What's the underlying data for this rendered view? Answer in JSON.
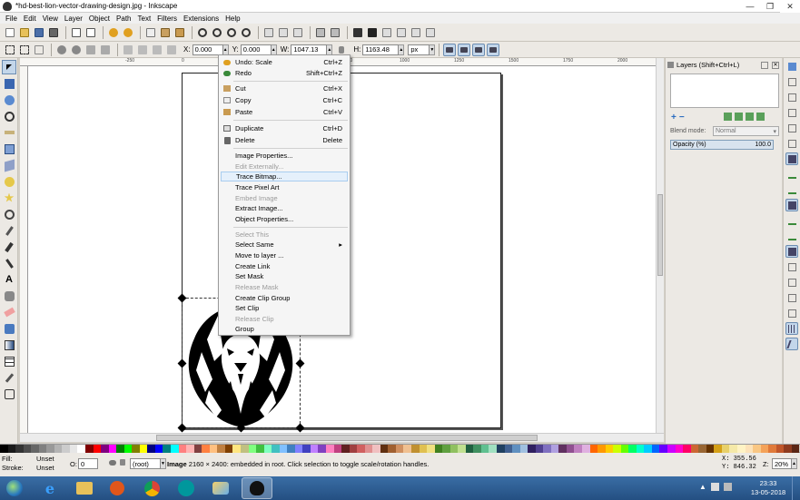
{
  "window": {
    "title": "*hd-best-lion-vector-drawing-design.jpg - Inkscape",
    "minimize_label": "—",
    "maximize_label": "❐",
    "close_label": "✕"
  },
  "menubar": [
    "File",
    "Edit",
    "View",
    "Layer",
    "Object",
    "Path",
    "Text",
    "Filters",
    "Extensions",
    "Help"
  ],
  "controls": {
    "x_label": "X:",
    "x_value": "0.000",
    "y_label": "Y:",
    "y_value": "0.000",
    "w_label": "W:",
    "w_value": "1047.13",
    "h_label": "H:",
    "h_value": "1163.48",
    "unit": "px"
  },
  "ruler_ticks": [
    "-250",
    "0",
    "250",
    "500",
    "750",
    "1000",
    "1250",
    "1500",
    "1750",
    "2000",
    "2250",
    "2500"
  ],
  "context_menu": [
    {
      "label": "Undo: Scale",
      "shortcut": "Ctrl+Z",
      "icon": "undo-icon",
      "enabled": true
    },
    {
      "label": "Redo",
      "shortcut": "Shift+Ctrl+Z",
      "icon": "redo-icon",
      "enabled": true
    },
    {
      "separator": true
    },
    {
      "label": "Cut",
      "shortcut": "Ctrl+X",
      "icon": "cut-icon",
      "enabled": true
    },
    {
      "label": "Copy",
      "shortcut": "Ctrl+C",
      "icon": "copy-icon",
      "enabled": true
    },
    {
      "label": "Paste",
      "shortcut": "Ctrl+V",
      "icon": "paste-icon",
      "enabled": true
    },
    {
      "separator": true
    },
    {
      "label": "Duplicate",
      "shortcut": "Ctrl+D",
      "icon": "duplicate-icon",
      "enabled": true
    },
    {
      "label": "Delete",
      "shortcut": "Delete",
      "icon": "delete-icon",
      "enabled": true
    },
    {
      "separator": true
    },
    {
      "label": "Image Properties...",
      "shortcut": "",
      "enabled": true
    },
    {
      "label": "Edit Externally...",
      "shortcut": "",
      "enabled": false
    },
    {
      "label": "Trace Bitmap...",
      "shortcut": "",
      "enabled": true,
      "highlighted": true
    },
    {
      "label": "Trace Pixel Art",
      "shortcut": "",
      "enabled": true
    },
    {
      "label": "Embed Image",
      "shortcut": "",
      "enabled": false
    },
    {
      "label": "Extract Image...",
      "shortcut": "",
      "enabled": true
    },
    {
      "label": "Object Properties...",
      "shortcut": "",
      "enabled": true
    },
    {
      "separator": true
    },
    {
      "label": "Select This",
      "shortcut": "",
      "enabled": false
    },
    {
      "label": "Select Same",
      "shortcut": "",
      "enabled": true,
      "submenu": true
    },
    {
      "label": "Move to layer ...",
      "shortcut": "",
      "enabled": true
    },
    {
      "label": "Create Link",
      "shortcut": "",
      "enabled": true
    },
    {
      "label": "Set Mask",
      "shortcut": "",
      "enabled": true
    },
    {
      "label": "Release Mask",
      "shortcut": "",
      "enabled": false
    },
    {
      "label": "Create Clip Group",
      "shortcut": "",
      "enabled": true
    },
    {
      "label": "Set Clip",
      "shortcut": "",
      "enabled": true
    },
    {
      "label": "Release Clip",
      "shortcut": "",
      "enabled": false
    },
    {
      "label": "Group",
      "shortcut": "",
      "enabled": true
    }
  ],
  "layers_panel": {
    "title": "Layers (Shift+Ctrl+L)",
    "blend_label": "Blend mode:",
    "blend_value": "Normal",
    "opacity_label": "Opacity (%)",
    "opacity_value": "100.0"
  },
  "status": {
    "fill_label": "Fill:",
    "fill_value": "Unset",
    "stroke_label": "Stroke:",
    "stroke_value": "Unset",
    "opacity_label": "O:",
    "opacity_value": "0",
    "layer_value": "(root)",
    "message_bold": "Image",
    "message": " 2160 × 2400: embedded in root. Click selection to toggle scale/rotation handles.",
    "x_label": "X:",
    "x_value": "355.56",
    "y_label": "Y:",
    "y_value": "846.32",
    "zoom_label": "Z:",
    "zoom_value": "20%"
  },
  "taskbar": {
    "time": "23:33",
    "date": "13-05-2018"
  },
  "colors": {
    "highlight": "#e5f0fb",
    "taskbar": "#2f5f95",
    "palette": [
      "#000000",
      "#1a1a1a",
      "#333333",
      "#4d4d4d",
      "#666666",
      "#808080",
      "#999999",
      "#b3b3b3",
      "#cccccc",
      "#e6e6e6",
      "#ffffff",
      "#800000",
      "#ff0000",
      "#800080",
      "#ff00ff",
      "#008000",
      "#00ff00",
      "#808000",
      "#ffff00",
      "#000080",
      "#0000ff",
      "#008080",
      "#00ffff",
      "#ff8080",
      "#ffb3b3",
      "#804040",
      "#ff8040",
      "#ffc080",
      "#c08040",
      "#804000",
      "#ffe680",
      "#c0c080",
      "#80ff80",
      "#40c040",
      "#80ffc0",
      "#40c0c0",
      "#80c0ff",
      "#4080c0",
      "#8080ff",
      "#4040c0",
      "#c080ff",
      "#8040c0",
      "#ff80c0",
      "#c04080",
      "#602020",
      "#a04040",
      "#d06060",
      "#e09090",
      "#f0c0c0",
      "#603010",
      "#a06030",
      "#d09060",
      "#f0c090",
      "#c09030",
      "#e0c050",
      "#f0e080",
      "#408020",
      "#60a040",
      "#90c060",
      "#c0e090",
      "#206040",
      "#409060",
      "#60c090",
      "#a0e0c0",
      "#204060",
      "#406090",
      "#6090c0",
      "#a0c0e0",
      "#302060",
      "#504090",
      "#8070c0",
      "#b0a0e0",
      "#603060",
      "#905090",
      "#c080c0",
      "#e0b0e0",
      "#ff6600",
      "#ff9900",
      "#ffcc00",
      "#ccff00",
      "#66ff00",
      "#00ff66",
      "#00ffcc",
      "#00ccff",
      "#0066ff",
      "#6600ff",
      "#cc00ff",
      "#ff00cc",
      "#ff0066",
      "#cc6633",
      "#996633",
      "#663300",
      "#d4a017",
      "#e8d06a",
      "#f5e9a8",
      "#fff3c4",
      "#fde2b8",
      "#f9c784",
      "#f4a259",
      "#e07a3a",
      "#c0562a",
      "#8e3b1f",
      "#5a2614"
    ]
  }
}
